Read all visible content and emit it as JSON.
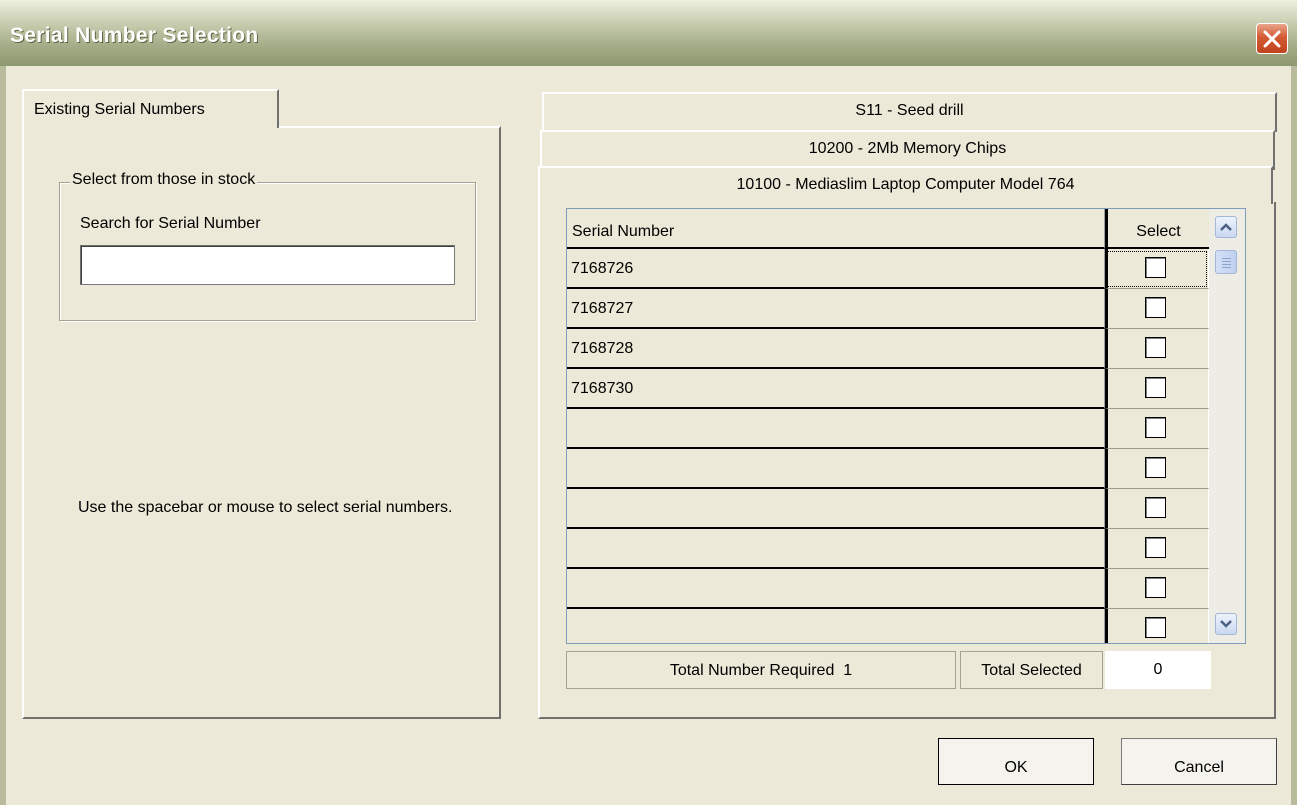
{
  "window": {
    "title": "Serial Number Selection"
  },
  "left_tab": {
    "label": "Existing Serial Numbers"
  },
  "stock_group": {
    "legend": "Select from those in stock",
    "search_label": "Search for Serial Number",
    "search_value": ""
  },
  "hint": "Use the spacebar or mouse to select serial numbers.",
  "product_tabs": [
    {
      "label": "S11 - Seed drill"
    },
    {
      "label": "10200 - 2Mb Memory Chips"
    },
    {
      "label": "10100 - Mediaslim Laptop Computer Model 764"
    }
  ],
  "grid": {
    "columns": {
      "serial": "Serial Number",
      "select": "Select"
    },
    "rows": [
      {
        "serial": "7168726",
        "checked": false
      },
      {
        "serial": "7168727",
        "checked": false
      },
      {
        "serial": "7168728",
        "checked": false
      },
      {
        "serial": "7168730",
        "checked": false
      },
      {
        "serial": "",
        "checked": false
      },
      {
        "serial": "",
        "checked": false
      },
      {
        "serial": "",
        "checked": false
      },
      {
        "serial": "",
        "checked": false
      },
      {
        "serial": "",
        "checked": false
      },
      {
        "serial": "",
        "checked": false
      }
    ]
  },
  "totals": {
    "required_label": "Total Number Required",
    "required_value": "1",
    "selected_label": "Total Selected",
    "selected_value": "0"
  },
  "buttons": {
    "ok": "OK",
    "cancel": "Cancel"
  },
  "icons": {
    "close": "close-icon",
    "scroll_up": "scroll-up-icon",
    "scroll_down": "scroll-down-icon"
  },
  "colors": {
    "face": "#ece9d8",
    "close_button": "#d35b35",
    "scrollbar_button": "#c9d8f1"
  }
}
